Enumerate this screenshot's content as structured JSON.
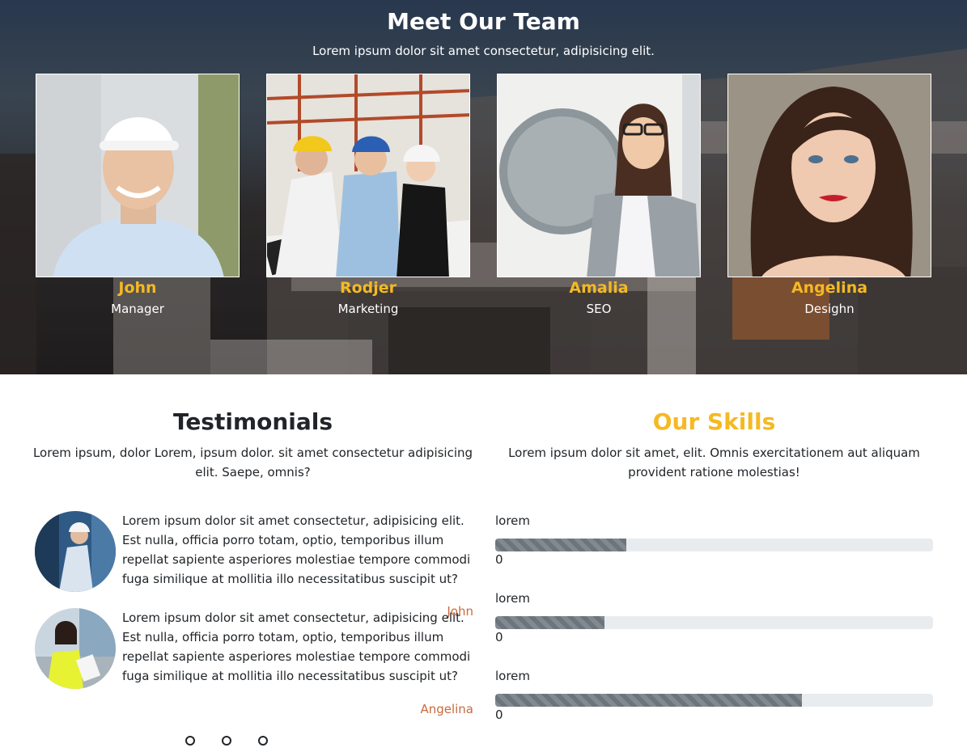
{
  "team": {
    "title": "Meet Our Team",
    "subtitle": "Lorem ipsum dolor sit amet consectetur, adipisicing elit.",
    "members": [
      {
        "name": "John",
        "role": "Manager"
      },
      {
        "name": "Rodjer",
        "role": "Marketing"
      },
      {
        "name": "Amalia",
        "role": "SEO"
      },
      {
        "name": "Angelina",
        "role": "Desighn"
      }
    ]
  },
  "testimonials": {
    "title": "Testimonials",
    "subtitle": "Lorem ipsum, dolor Lorem, ipsum dolor. sit amet consectetur adipisicing elit. Saepe, omnis?",
    "items": [
      {
        "text": "Lorem ipsum dolor sit amet consectetur, adipisicing elit. Est nulla, officia porro totam, optio, temporibus illum repellat sapiente asperiores molestiae tempore commodi fuga similique at mollitia illo necessitatibus suscipit ut?",
        "author": "John"
      },
      {
        "text": "Lorem ipsum dolor sit amet consectetur, adipisicing elit. Est nulla, officia porro totam, optio, temporibus illum repellat sapiente asperiores molestiae tempore commodi fuga similique at mollitia illo necessitatibus suscipit ut?",
        "author": "Angelina"
      }
    ],
    "carousel_dots": 3
  },
  "skills": {
    "title": "Our Skills",
    "subtitle": "Lorem ipsum dolor sit amet, elit. Omnis exercitationem aut aliquam provident ratione molestias!",
    "items": [
      {
        "label": "lorem",
        "progress_percent": 30,
        "value": "0"
      },
      {
        "label": "lorem",
        "progress_percent": 25,
        "value": "0"
      },
      {
        "label": "lorem",
        "progress_percent": 70,
        "value": "0"
      }
    ]
  },
  "colors": {
    "accent_yellow": "#f5b921",
    "author_orange": "#c96a3e",
    "progress_fill": "#6c757d",
    "progress_track": "#e9ecef"
  }
}
